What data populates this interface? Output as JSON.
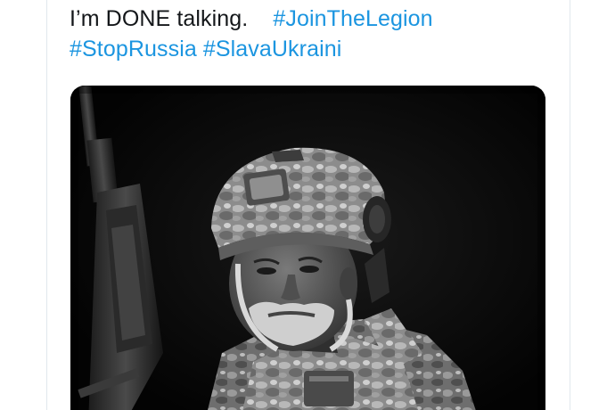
{
  "tweet": {
    "text_plain": "I’m DONE talking.",
    "hashtags": [
      "#JoinTheLegion",
      "#StopRussia",
      "#SlavaUkraini"
    ]
  },
  "media": {
    "kind": "photo",
    "style": "black-and-white",
    "subject": "soldier-with-rifle"
  },
  "colors": {
    "text": "#14171a",
    "hashtag": "#1b95e0",
    "border": "#e1e8ed",
    "photo_background": "#050505"
  }
}
